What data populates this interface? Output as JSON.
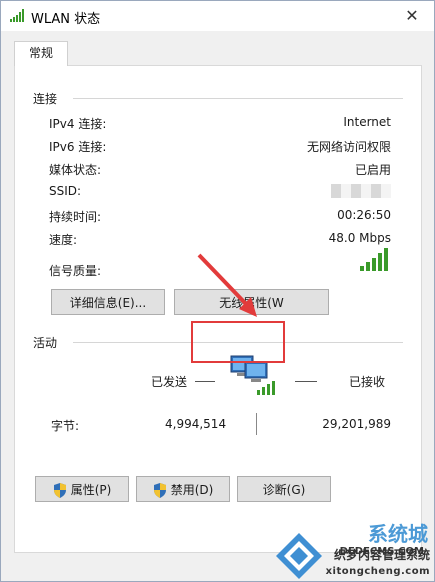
{
  "window": {
    "title": "WLAN 状态",
    "close_glyph": "✕"
  },
  "tab": {
    "label": "常规"
  },
  "connection": {
    "title": "连接",
    "rows": [
      {
        "label": "IPv4 连接:",
        "value": "Internet"
      },
      {
        "label": "IPv6 连接:",
        "value": "无网络访问权限"
      },
      {
        "label": "媒体状态:",
        "value": "已启用"
      },
      {
        "label": "SSID:",
        "value": ""
      },
      {
        "label": "持续时间:",
        "value": "00:26:50"
      },
      {
        "label": "速度:",
        "value": "48.0 Mbps"
      },
      {
        "label": "信号质量:",
        "value": ""
      }
    ],
    "details_button": "详细信息(E)...",
    "wireless_button": "无线属性(W"
  },
  "activity": {
    "title": "活动",
    "sent_label": "已发送",
    "received_label": "已接收",
    "bytes_label": "字节:",
    "bytes_sent": "4,994,514",
    "bytes_received": "29,201,989"
  },
  "buttons": {
    "properties": "属性(P)",
    "disable": "禁用(D)",
    "diagnose": "诊断(G)"
  },
  "watermark": {
    "big": "系统城",
    "line1": "织梦内容管理系统",
    "line2": "DEDECMS.COM",
    "line3": "xitongcheng.com"
  },
  "colors": {
    "accent": "#4c9ad6",
    "highlight": "#e23b3b",
    "signal": "#3a9a2a"
  }
}
